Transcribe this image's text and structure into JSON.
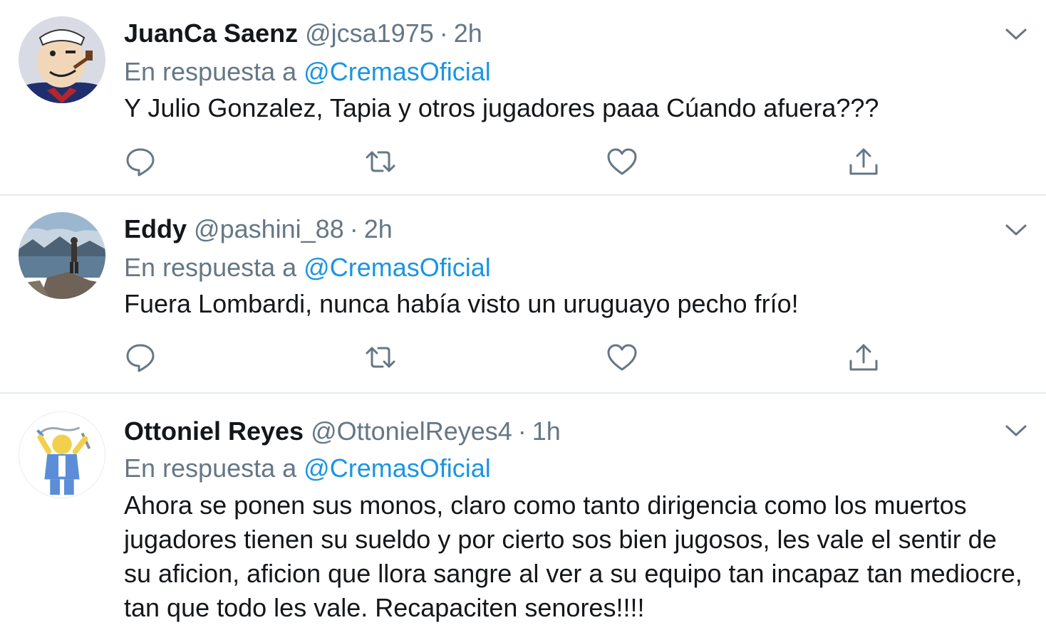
{
  "colors": {
    "name": "#14171a",
    "secondary": "#657786",
    "link": "#1b95e0",
    "divider": "#e6ecf0",
    "icon": "#657786"
  },
  "tweets": [
    {
      "name": "JuanCa Saenz",
      "handle": "@jcsa1975",
      "separator": "·",
      "time": "2h",
      "reply_prefix": "En respuesta a",
      "reply_mention": "@CremasOficial",
      "text": "Y Julio Gonzalez, Tapia y otros jugadores paaa Cúando afuera???",
      "avatar_icon": "popeye-avatar"
    },
    {
      "name": "Eddy",
      "handle": "@pashini_88",
      "separator": "·",
      "time": "2h",
      "reply_prefix": "En respuesta a",
      "reply_mention": "@CremasOficial",
      "text": "Fuera Lombardi, nunca había visto un uruguayo pecho frío!",
      "avatar_icon": "lake-landscape-avatar"
    },
    {
      "name": "Ottoniel Reyes",
      "handle": "@OttonielReyes4",
      "separator": "·",
      "time": "1h",
      "reply_prefix": "En respuesta a",
      "reply_mention": "@CremasOficial",
      "text": "Ahora se ponen sus monos, claro como tanto dirigencia como los muertos jugadores tienen su sueldo y por cierto sos bien jugosos, les vale el sentir de su aficion, aficion que llora sangre al ver a su equipo tan incapaz tan mediocre, tan que todo les vale. Recapaciten senores!!!!",
      "avatar_icon": "cartoon-fan-avatar"
    }
  ],
  "actions": [
    "reply-icon",
    "retweet-icon",
    "like-icon",
    "share-icon"
  ]
}
